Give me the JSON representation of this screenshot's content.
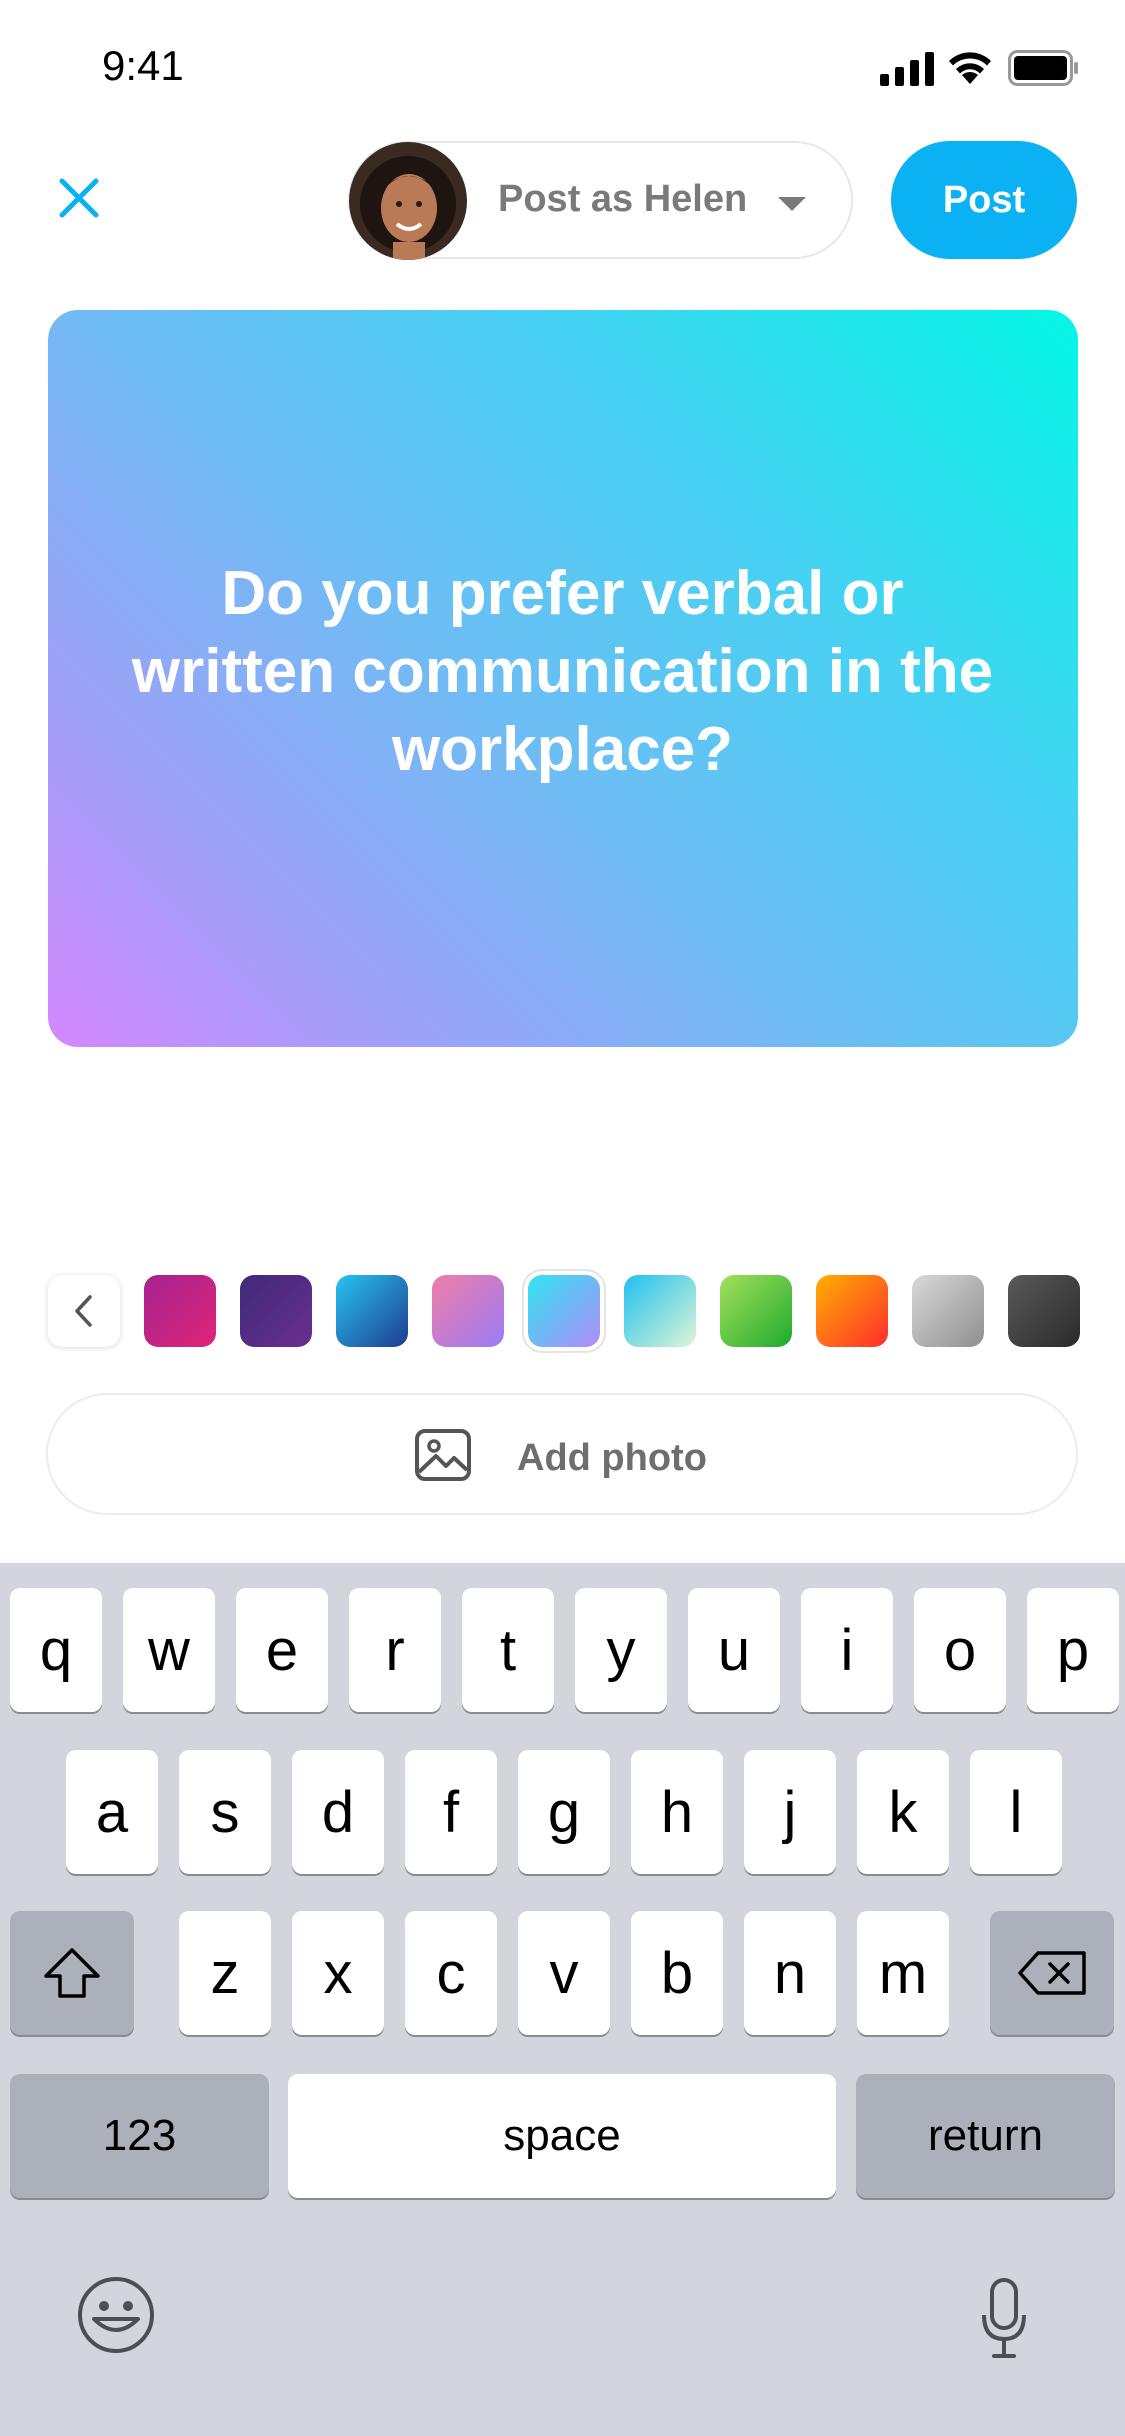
{
  "status_bar": {
    "time": "9:41"
  },
  "header": {
    "poster_label": "Post as Helen",
    "post_button": "Post"
  },
  "card": {
    "text": "Do you prefer verbal or written communication in the workplace?"
  },
  "swatches": [
    {
      "name": "magenta",
      "from": "#a4238f",
      "to": "#e0247a"
    },
    {
      "name": "purple",
      "from": "#3f2a78",
      "to": "#6a2f8e"
    },
    {
      "name": "ocean",
      "from": "#27c4f0",
      "to": "#1e3c8f"
    },
    {
      "name": "pink-lavender",
      "from": "#f07da6",
      "to": "#9b7cf5"
    },
    {
      "name": "cyan-lavender",
      "from": "#2ee5f0",
      "to": "#b18cfa",
      "selected": true
    },
    {
      "name": "aqua-mint",
      "from": "#1fc0f0",
      "to": "#dff5d5"
    },
    {
      "name": "green",
      "from": "#a4e05a",
      "to": "#1eaa2e"
    },
    {
      "name": "orange",
      "from": "#ffb000",
      "to": "#ff2d2d"
    },
    {
      "name": "silver",
      "from": "#d9d9d9",
      "to": "#8f8f8f"
    },
    {
      "name": "charcoal",
      "from": "#5a5a5a",
      "to": "#2a2a2a"
    }
  ],
  "add_photo": {
    "label": "Add photo"
  },
  "keyboard": {
    "row1": [
      "q",
      "w",
      "e",
      "r",
      "t",
      "y",
      "u",
      "i",
      "o",
      "p"
    ],
    "row2": [
      "a",
      "s",
      "d",
      "f",
      "g",
      "h",
      "j",
      "k",
      "l"
    ],
    "row3": [
      "z",
      "x",
      "c",
      "v",
      "b",
      "n",
      "m"
    ],
    "numbers": "123",
    "space": "space",
    "return": "return"
  }
}
